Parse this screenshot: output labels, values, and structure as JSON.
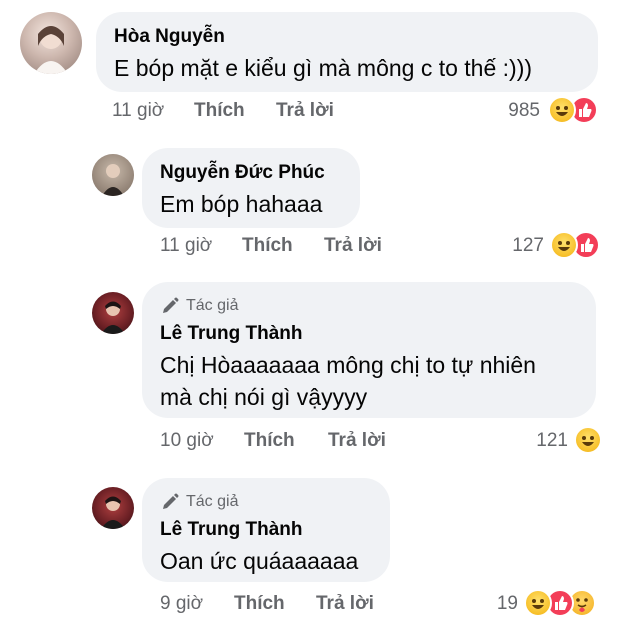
{
  "comments": [
    {
      "name": "Hòa Nguyễn",
      "text_lines": [
        "E bóp mặt e kiểu gì mà mông c to thế :)))"
      ],
      "time": "11 giờ",
      "like_label": "Thích",
      "reply_label": "Trả lời",
      "reaction_count": "985",
      "reactions": [
        "haha",
        "like"
      ]
    },
    {
      "name": "Nguyễn Đức Phúc",
      "text_lines": [
        "Em bóp hahaaa"
      ],
      "time": "11 giờ",
      "like_label": "Thích",
      "reply_label": "Trả lời",
      "reaction_count": "127",
      "reactions": [
        "haha",
        "like"
      ]
    },
    {
      "badge": "Tác giả",
      "name": "Lê Trung Thành",
      "text_lines": [
        "Chị Hòaaaaaaa mông chị to tự nhiên",
        "mà chị nói gì vậyyyy"
      ],
      "time": "10 giờ",
      "like_label": "Thích",
      "reply_label": "Trả lời",
      "reaction_count": "121",
      "reactions": [
        "haha"
      ]
    },
    {
      "badge": "Tác giả",
      "name": "Lê Trung Thành",
      "text_lines": [
        "Oan ức quáaaaaaa"
      ],
      "time": "9 giờ",
      "like_label": "Thích",
      "reply_label": "Trả lời",
      "reaction_count": "19",
      "reactions": [
        "haha",
        "like",
        "care"
      ]
    }
  ],
  "colors": {
    "bubble": "#f0f2f5",
    "meta_text": "#65676b",
    "like_reaction": "#f33e58",
    "haha_reaction": "#f7c02a"
  }
}
